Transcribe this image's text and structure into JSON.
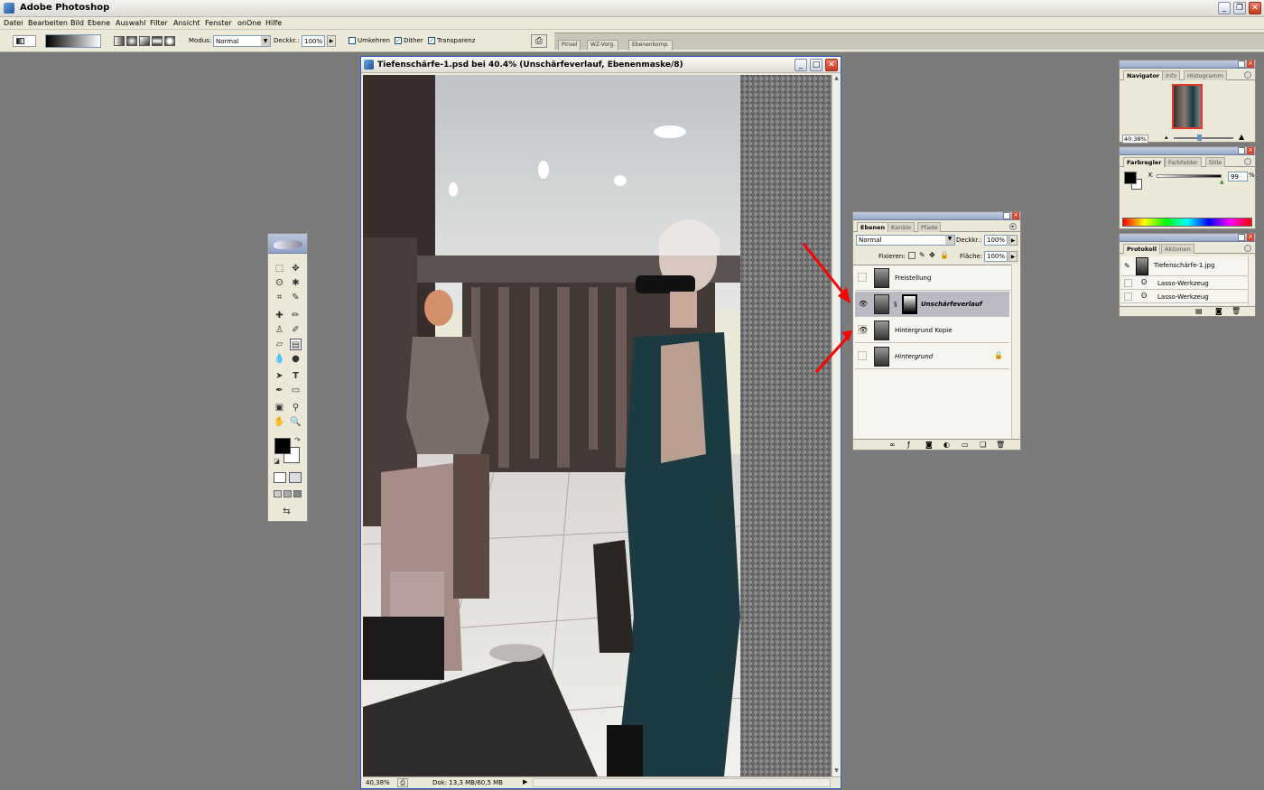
{
  "app": {
    "title": "Adobe Photoshop"
  },
  "menu": [
    "Datei",
    "Bearbeiten",
    "Bild",
    "Ebene",
    "Auswahl",
    "Filter",
    "Ansicht",
    "Fenster",
    "onOne",
    "Hilfe"
  ],
  "options": {
    "modus_label": "Modus:",
    "modus_value": "Normal",
    "deckkraft_label": "Deckkr.:",
    "deckkraft_value": "100%",
    "umkehren": "Umkehren",
    "dither": "Dither",
    "transparenz": "Transparenz"
  },
  "palette_well": [
    "Pinsel",
    "WZ-Vorg.",
    "Ebenenkomp."
  ],
  "document": {
    "title": "Tiefenschärfe-1.psd bei 40.4% (Unschärfeverlauf, Ebenenmaske/8)",
    "zoom": "40,38%",
    "doc_info": "Dok: 13,3 MB/60,5 MB"
  },
  "navigator": {
    "tabs": [
      "Navigator",
      "Info",
      "Histogramm"
    ],
    "zoom": "40.38%"
  },
  "color": {
    "tabs": [
      "Farbregler",
      "Farbfelder",
      "Stile"
    ],
    "channel": "K",
    "value": "99",
    "unit": "%"
  },
  "history": {
    "tabs": [
      "Protokoll",
      "Aktionen"
    ],
    "snapshot": "Tiefenschärfe-1.jpg",
    "items": [
      "Lasso-Werkzeug",
      "Lasso-Werkzeug"
    ]
  },
  "layers": {
    "tabs": [
      "Ebenen",
      "Kanäle",
      "Pfade"
    ],
    "blend_mode": "Normal",
    "opacity_label": "Deckkr.:",
    "opacity": "100%",
    "lock_label": "Fixieren:",
    "fill_label": "Fläche:",
    "fill": "100%",
    "items": [
      {
        "name": "Freistellung",
        "visible": false,
        "selected": false
      },
      {
        "name": "Unschärfeverlauf",
        "visible": true,
        "selected": true
      },
      {
        "name": "Hintergrund Kopie",
        "visible": true,
        "selected": false
      },
      {
        "name": "Hintergrund",
        "visible": false,
        "selected": false
      }
    ]
  },
  "colors": {
    "annotation_arrow": "#ff0000",
    "title_active": "#2a5dbf"
  }
}
